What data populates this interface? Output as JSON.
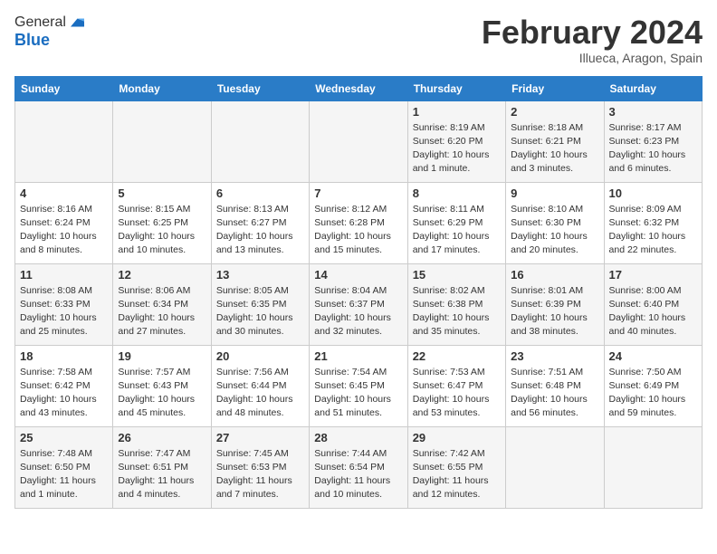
{
  "header": {
    "logo_line1": "General",
    "logo_line2": "Blue",
    "month_title": "February 2024",
    "location": "Illueca, Aragon, Spain"
  },
  "weekdays": [
    "Sunday",
    "Monday",
    "Tuesday",
    "Wednesday",
    "Thursday",
    "Friday",
    "Saturday"
  ],
  "weeks": [
    [
      {
        "day": "",
        "info": ""
      },
      {
        "day": "",
        "info": ""
      },
      {
        "day": "",
        "info": ""
      },
      {
        "day": "",
        "info": ""
      },
      {
        "day": "1",
        "info": "Sunrise: 8:19 AM\nSunset: 6:20 PM\nDaylight: 10 hours\nand 1 minute."
      },
      {
        "day": "2",
        "info": "Sunrise: 8:18 AM\nSunset: 6:21 PM\nDaylight: 10 hours\nand 3 minutes."
      },
      {
        "day": "3",
        "info": "Sunrise: 8:17 AM\nSunset: 6:23 PM\nDaylight: 10 hours\nand 6 minutes."
      }
    ],
    [
      {
        "day": "4",
        "info": "Sunrise: 8:16 AM\nSunset: 6:24 PM\nDaylight: 10 hours\nand 8 minutes."
      },
      {
        "day": "5",
        "info": "Sunrise: 8:15 AM\nSunset: 6:25 PM\nDaylight: 10 hours\nand 10 minutes."
      },
      {
        "day": "6",
        "info": "Sunrise: 8:13 AM\nSunset: 6:27 PM\nDaylight: 10 hours\nand 13 minutes."
      },
      {
        "day": "7",
        "info": "Sunrise: 8:12 AM\nSunset: 6:28 PM\nDaylight: 10 hours\nand 15 minutes."
      },
      {
        "day": "8",
        "info": "Sunrise: 8:11 AM\nSunset: 6:29 PM\nDaylight: 10 hours\nand 17 minutes."
      },
      {
        "day": "9",
        "info": "Sunrise: 8:10 AM\nSunset: 6:30 PM\nDaylight: 10 hours\nand 20 minutes."
      },
      {
        "day": "10",
        "info": "Sunrise: 8:09 AM\nSunset: 6:32 PM\nDaylight: 10 hours\nand 22 minutes."
      }
    ],
    [
      {
        "day": "11",
        "info": "Sunrise: 8:08 AM\nSunset: 6:33 PM\nDaylight: 10 hours\nand 25 minutes."
      },
      {
        "day": "12",
        "info": "Sunrise: 8:06 AM\nSunset: 6:34 PM\nDaylight: 10 hours\nand 27 minutes."
      },
      {
        "day": "13",
        "info": "Sunrise: 8:05 AM\nSunset: 6:35 PM\nDaylight: 10 hours\nand 30 minutes."
      },
      {
        "day": "14",
        "info": "Sunrise: 8:04 AM\nSunset: 6:37 PM\nDaylight: 10 hours\nand 32 minutes."
      },
      {
        "day": "15",
        "info": "Sunrise: 8:02 AM\nSunset: 6:38 PM\nDaylight: 10 hours\nand 35 minutes."
      },
      {
        "day": "16",
        "info": "Sunrise: 8:01 AM\nSunset: 6:39 PM\nDaylight: 10 hours\nand 38 minutes."
      },
      {
        "day": "17",
        "info": "Sunrise: 8:00 AM\nSunset: 6:40 PM\nDaylight: 10 hours\nand 40 minutes."
      }
    ],
    [
      {
        "day": "18",
        "info": "Sunrise: 7:58 AM\nSunset: 6:42 PM\nDaylight: 10 hours\nand 43 minutes."
      },
      {
        "day": "19",
        "info": "Sunrise: 7:57 AM\nSunset: 6:43 PM\nDaylight: 10 hours\nand 45 minutes."
      },
      {
        "day": "20",
        "info": "Sunrise: 7:56 AM\nSunset: 6:44 PM\nDaylight: 10 hours\nand 48 minutes."
      },
      {
        "day": "21",
        "info": "Sunrise: 7:54 AM\nSunset: 6:45 PM\nDaylight: 10 hours\nand 51 minutes."
      },
      {
        "day": "22",
        "info": "Sunrise: 7:53 AM\nSunset: 6:47 PM\nDaylight: 10 hours\nand 53 minutes."
      },
      {
        "day": "23",
        "info": "Sunrise: 7:51 AM\nSunset: 6:48 PM\nDaylight: 10 hours\nand 56 minutes."
      },
      {
        "day": "24",
        "info": "Sunrise: 7:50 AM\nSunset: 6:49 PM\nDaylight: 10 hours\nand 59 minutes."
      }
    ],
    [
      {
        "day": "25",
        "info": "Sunrise: 7:48 AM\nSunset: 6:50 PM\nDaylight: 11 hours\nand 1 minute."
      },
      {
        "day": "26",
        "info": "Sunrise: 7:47 AM\nSunset: 6:51 PM\nDaylight: 11 hours\nand 4 minutes."
      },
      {
        "day": "27",
        "info": "Sunrise: 7:45 AM\nSunset: 6:53 PM\nDaylight: 11 hours\nand 7 minutes."
      },
      {
        "day": "28",
        "info": "Sunrise: 7:44 AM\nSunset: 6:54 PM\nDaylight: 11 hours\nand 10 minutes."
      },
      {
        "day": "29",
        "info": "Sunrise: 7:42 AM\nSunset: 6:55 PM\nDaylight: 11 hours\nand 12 minutes."
      },
      {
        "day": "",
        "info": ""
      },
      {
        "day": "",
        "info": ""
      }
    ]
  ]
}
